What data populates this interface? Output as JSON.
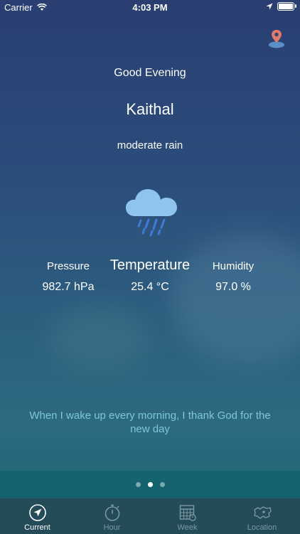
{
  "status_bar": {
    "carrier": "Carrier",
    "time": "4:03 PM",
    "battery_level": 0.9
  },
  "main": {
    "greeting": "Good Evening",
    "city": "Kaithal",
    "condition": "moderate rain",
    "weather_icon": "rain-cloud-icon",
    "stats": {
      "pressure_label": "Pressure",
      "pressure_value": "982.7 hPa",
      "temperature_label": "Temperature",
      "temperature_value": "25.4 °C",
      "humidity_label": "Humidity",
      "humidity_value": "97.0 %"
    },
    "quote": "When I wake up every morning, I thank God for the new day"
  },
  "pager": {
    "pages": 3,
    "active_index": 1
  },
  "tabbar": {
    "tabs": [
      {
        "label": "Current",
        "icon": "navigation-arrow-icon",
        "active": true
      },
      {
        "label": "Hour",
        "icon": "stopwatch-icon",
        "active": false
      },
      {
        "label": "Week",
        "icon": "calendar-grid-icon",
        "active": false
      },
      {
        "label": "Location",
        "icon": "map-icon",
        "active": false
      }
    ]
  },
  "colors": {
    "accent_quote": "#7fc7d6",
    "tab_bar": "#244b58",
    "pager_band": "#15636f",
    "pin_top": "#e07a6a",
    "pin_base": "#5b8fc9",
    "cloud": "#8fc4ef",
    "rain": "#3d7bd6"
  }
}
